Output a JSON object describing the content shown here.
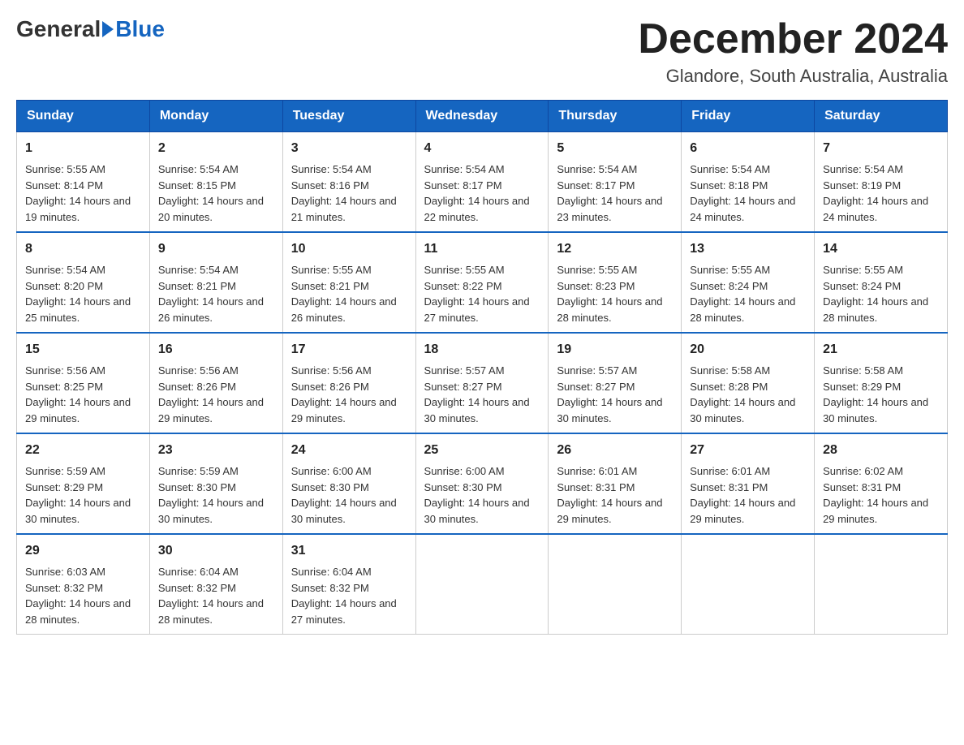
{
  "logo": {
    "general": "General",
    "blue": "Blue"
  },
  "header": {
    "title": "December 2024",
    "location": "Glandore, South Australia, Australia"
  },
  "days_of_week": [
    "Sunday",
    "Monday",
    "Tuesday",
    "Wednesday",
    "Thursday",
    "Friday",
    "Saturday"
  ],
  "weeks": [
    [
      {
        "day": "1",
        "sunrise": "5:55 AM",
        "sunset": "8:14 PM",
        "daylight": "14 hours and 19 minutes."
      },
      {
        "day": "2",
        "sunrise": "5:54 AM",
        "sunset": "8:15 PM",
        "daylight": "14 hours and 20 minutes."
      },
      {
        "day": "3",
        "sunrise": "5:54 AM",
        "sunset": "8:16 PM",
        "daylight": "14 hours and 21 minutes."
      },
      {
        "day": "4",
        "sunrise": "5:54 AM",
        "sunset": "8:17 PM",
        "daylight": "14 hours and 22 minutes."
      },
      {
        "day": "5",
        "sunrise": "5:54 AM",
        "sunset": "8:17 PM",
        "daylight": "14 hours and 23 minutes."
      },
      {
        "day": "6",
        "sunrise": "5:54 AM",
        "sunset": "8:18 PM",
        "daylight": "14 hours and 24 minutes."
      },
      {
        "day": "7",
        "sunrise": "5:54 AM",
        "sunset": "8:19 PM",
        "daylight": "14 hours and 24 minutes."
      }
    ],
    [
      {
        "day": "8",
        "sunrise": "5:54 AM",
        "sunset": "8:20 PM",
        "daylight": "14 hours and 25 minutes."
      },
      {
        "day": "9",
        "sunrise": "5:54 AM",
        "sunset": "8:21 PM",
        "daylight": "14 hours and 26 minutes."
      },
      {
        "day": "10",
        "sunrise": "5:55 AM",
        "sunset": "8:21 PM",
        "daylight": "14 hours and 26 minutes."
      },
      {
        "day": "11",
        "sunrise": "5:55 AM",
        "sunset": "8:22 PM",
        "daylight": "14 hours and 27 minutes."
      },
      {
        "day": "12",
        "sunrise": "5:55 AM",
        "sunset": "8:23 PM",
        "daylight": "14 hours and 28 minutes."
      },
      {
        "day": "13",
        "sunrise": "5:55 AM",
        "sunset": "8:24 PM",
        "daylight": "14 hours and 28 minutes."
      },
      {
        "day": "14",
        "sunrise": "5:55 AM",
        "sunset": "8:24 PM",
        "daylight": "14 hours and 28 minutes."
      }
    ],
    [
      {
        "day": "15",
        "sunrise": "5:56 AM",
        "sunset": "8:25 PM",
        "daylight": "14 hours and 29 minutes."
      },
      {
        "day": "16",
        "sunrise": "5:56 AM",
        "sunset": "8:26 PM",
        "daylight": "14 hours and 29 minutes."
      },
      {
        "day": "17",
        "sunrise": "5:56 AM",
        "sunset": "8:26 PM",
        "daylight": "14 hours and 29 minutes."
      },
      {
        "day": "18",
        "sunrise": "5:57 AM",
        "sunset": "8:27 PM",
        "daylight": "14 hours and 30 minutes."
      },
      {
        "day": "19",
        "sunrise": "5:57 AM",
        "sunset": "8:27 PM",
        "daylight": "14 hours and 30 minutes."
      },
      {
        "day": "20",
        "sunrise": "5:58 AM",
        "sunset": "8:28 PM",
        "daylight": "14 hours and 30 minutes."
      },
      {
        "day": "21",
        "sunrise": "5:58 AM",
        "sunset": "8:29 PM",
        "daylight": "14 hours and 30 minutes."
      }
    ],
    [
      {
        "day": "22",
        "sunrise": "5:59 AM",
        "sunset": "8:29 PM",
        "daylight": "14 hours and 30 minutes."
      },
      {
        "day": "23",
        "sunrise": "5:59 AM",
        "sunset": "8:30 PM",
        "daylight": "14 hours and 30 minutes."
      },
      {
        "day": "24",
        "sunrise": "6:00 AM",
        "sunset": "8:30 PM",
        "daylight": "14 hours and 30 minutes."
      },
      {
        "day": "25",
        "sunrise": "6:00 AM",
        "sunset": "8:30 PM",
        "daylight": "14 hours and 30 minutes."
      },
      {
        "day": "26",
        "sunrise": "6:01 AM",
        "sunset": "8:31 PM",
        "daylight": "14 hours and 29 minutes."
      },
      {
        "day": "27",
        "sunrise": "6:01 AM",
        "sunset": "8:31 PM",
        "daylight": "14 hours and 29 minutes."
      },
      {
        "day": "28",
        "sunrise": "6:02 AM",
        "sunset": "8:31 PM",
        "daylight": "14 hours and 29 minutes."
      }
    ],
    [
      {
        "day": "29",
        "sunrise": "6:03 AM",
        "sunset": "8:32 PM",
        "daylight": "14 hours and 28 minutes."
      },
      {
        "day": "30",
        "sunrise": "6:04 AM",
        "sunset": "8:32 PM",
        "daylight": "14 hours and 28 minutes."
      },
      {
        "day": "31",
        "sunrise": "6:04 AM",
        "sunset": "8:32 PM",
        "daylight": "14 hours and 27 minutes."
      },
      null,
      null,
      null,
      null
    ]
  ],
  "labels": {
    "sunrise": "Sunrise:",
    "sunset": "Sunset:",
    "daylight": "Daylight:"
  }
}
